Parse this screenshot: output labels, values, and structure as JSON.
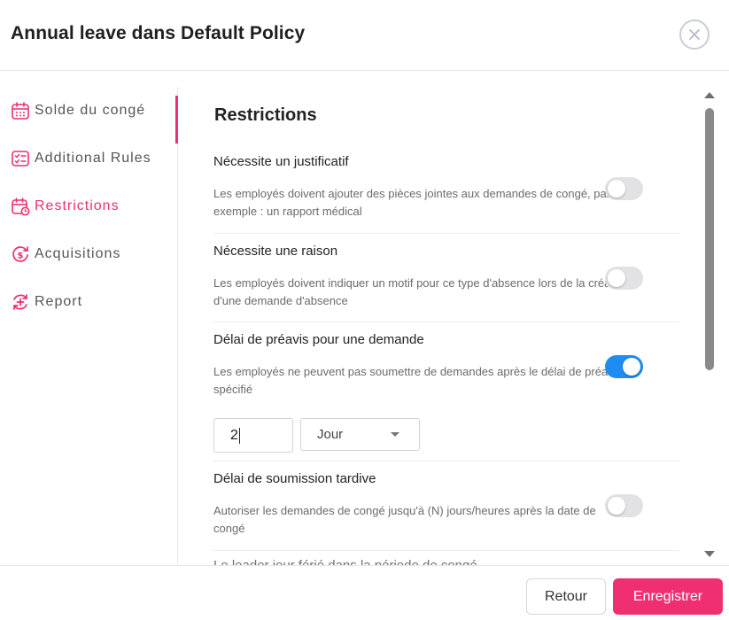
{
  "header": {
    "title": "Annual leave dans Default Policy",
    "close_icon": "close-icon"
  },
  "sidebar": {
    "items": [
      {
        "label": "Solde du congé",
        "icon": "calendar-grid-icon",
        "active": false
      },
      {
        "label": "Additional Rules",
        "icon": "checklist-icon",
        "active": false
      },
      {
        "label": "Restrictions",
        "icon": "calendar-clock-icon",
        "active": true
      },
      {
        "label": "Acquisitions",
        "icon": "dollar-refresh-icon",
        "active": false
      },
      {
        "label": "Report",
        "icon": "plus-refresh-icon",
        "active": false
      }
    ]
  },
  "main": {
    "section_title": "Restrictions",
    "rules": [
      {
        "title": "Nécessite un justificatif",
        "description": "Les employés doivent ajouter des pièces jointes aux demandes de congé, par exemple : un rapport médical",
        "enabled": false
      },
      {
        "title": "Nécessite une raison",
        "description": "Les employés doivent indiquer un motif pour ce type d'absence lors de la création d'une demande d'absence",
        "enabled": false
      },
      {
        "title": "Délai de préavis pour une demande",
        "description": "Les employés ne peuvent pas soumettre de demandes après le délai de préavis spécifié",
        "enabled": true
      },
      {
        "title": "Délai de soumission tardive",
        "description": "Autoriser les demandes de congé jusqu'à (N) jours/heures après la date de congé",
        "enabled": false
      }
    ],
    "notice_value": "2",
    "notice_unit": "Jour",
    "cut_off_text": "Le leader jour férié dans la période de congé"
  },
  "footer": {
    "back_label": "Retour",
    "save_label": "Enregistrer"
  },
  "colors": {
    "accent": "#ec2f72",
    "toggle_on": "#1e8cf0",
    "toggle_off": "#e2e2e4"
  }
}
